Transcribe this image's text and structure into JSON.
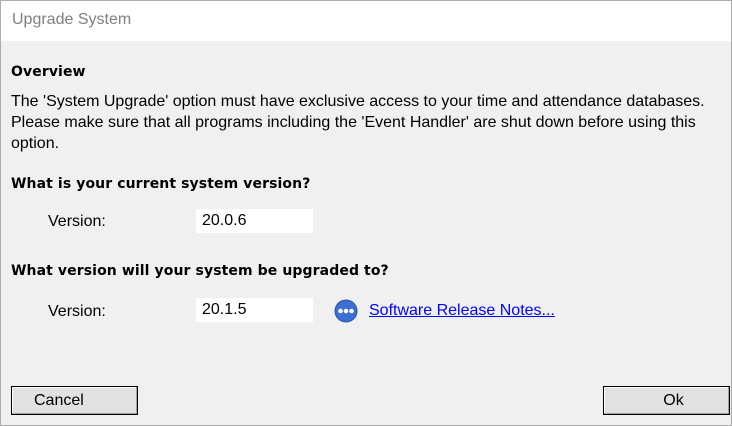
{
  "window": {
    "title": "Upgrade System"
  },
  "overview": {
    "heading": "Overview",
    "text": "The 'System Upgrade' option must have exclusive access to your time and attendance databases. Please make sure that all programs including the 'Event Handler' are shut down before using this option."
  },
  "current_version": {
    "heading": "What is your current system version?",
    "label": "Version:",
    "value": "20.0.6"
  },
  "target_version": {
    "heading": "What version will your system be upgraded to?",
    "label": "Version:",
    "value": "20.1.5",
    "link_icon": "more-dots-icon",
    "link_label": "Software Release Notes..."
  },
  "buttons": {
    "cancel_label": "Cancel",
    "ok_label": "Ok"
  },
  "colors": {
    "link": "#0000ff",
    "icon_fill": "#3c6fd1",
    "dialog_bg": "#f0f0f0"
  }
}
